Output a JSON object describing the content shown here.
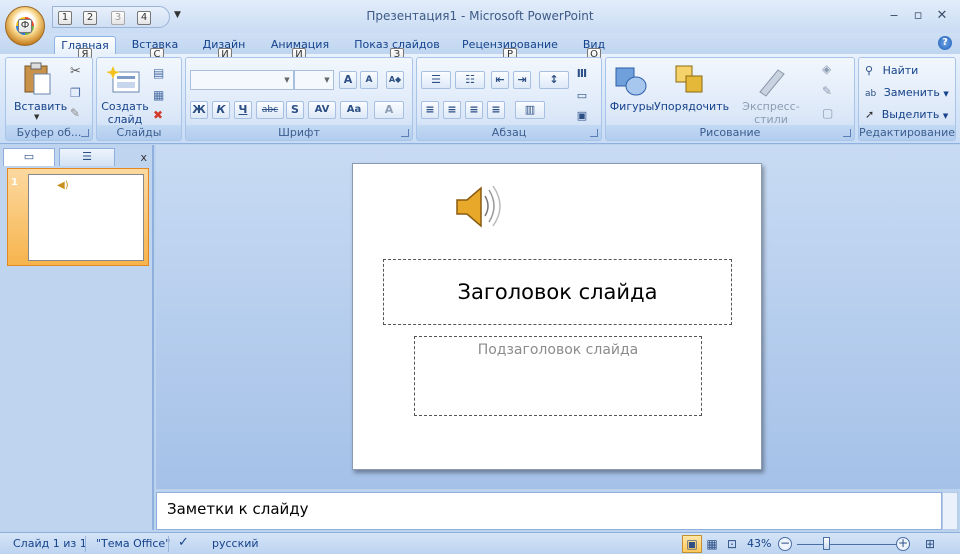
{
  "window": {
    "title": "Презентация1 - Microsoft PowerPoint"
  },
  "office_button": {
    "keytip": "Ф"
  },
  "qat": {
    "keytips": [
      "1",
      "2",
      "3",
      "4"
    ]
  },
  "tabs": [
    {
      "label": "Главная",
      "keytip": "Я",
      "active": true
    },
    {
      "label": "Вставка",
      "keytip": "С"
    },
    {
      "label": "Дизайн",
      "keytip": "И"
    },
    {
      "label": "Анимация",
      "keytip": "И"
    },
    {
      "label": "Показ слайдов",
      "keytip": "З"
    },
    {
      "label": "Рецензирование",
      "keytip": "Р"
    },
    {
      "label": "Вид",
      "keytip": "О"
    }
  ],
  "ribbon": {
    "clipboard": {
      "label": "Буфер об...",
      "paste": "Вставить"
    },
    "slides": {
      "label": "Слайды",
      "new_slide_1": "Создать",
      "new_slide_2": "слайд"
    },
    "font": {
      "label": "Шрифт",
      "bold": "Ж",
      "italic": "К",
      "underline": "Ч",
      "strike": "abc",
      "shadow": "S",
      "spacing": "AV",
      "case": "Aa",
      "color": "A",
      "grow": "A",
      "shrink": "A"
    },
    "paragraph": {
      "label": "Абзац"
    },
    "drawing": {
      "label": "Рисование",
      "shapes": "Фигуры",
      "arrange": "Упорядочить",
      "quick_styles": "Экспресс-стили"
    },
    "editing": {
      "label": "Редактирование",
      "find": "Найти",
      "replace": "Заменить",
      "select": "Выделить"
    }
  },
  "pane": {
    "close": "x",
    "slide_number": "1"
  },
  "slide": {
    "title": "Заголовок слайда",
    "subtitle": "Подзаголовок слайда"
  },
  "notes": {
    "text": "Заметки к слайду"
  },
  "status": {
    "slide_info": "Слайд 1 из 1",
    "theme": "\"Тема Office\"",
    "language": "русский",
    "zoom": "43%",
    "zoom_fraction": 0.3
  }
}
